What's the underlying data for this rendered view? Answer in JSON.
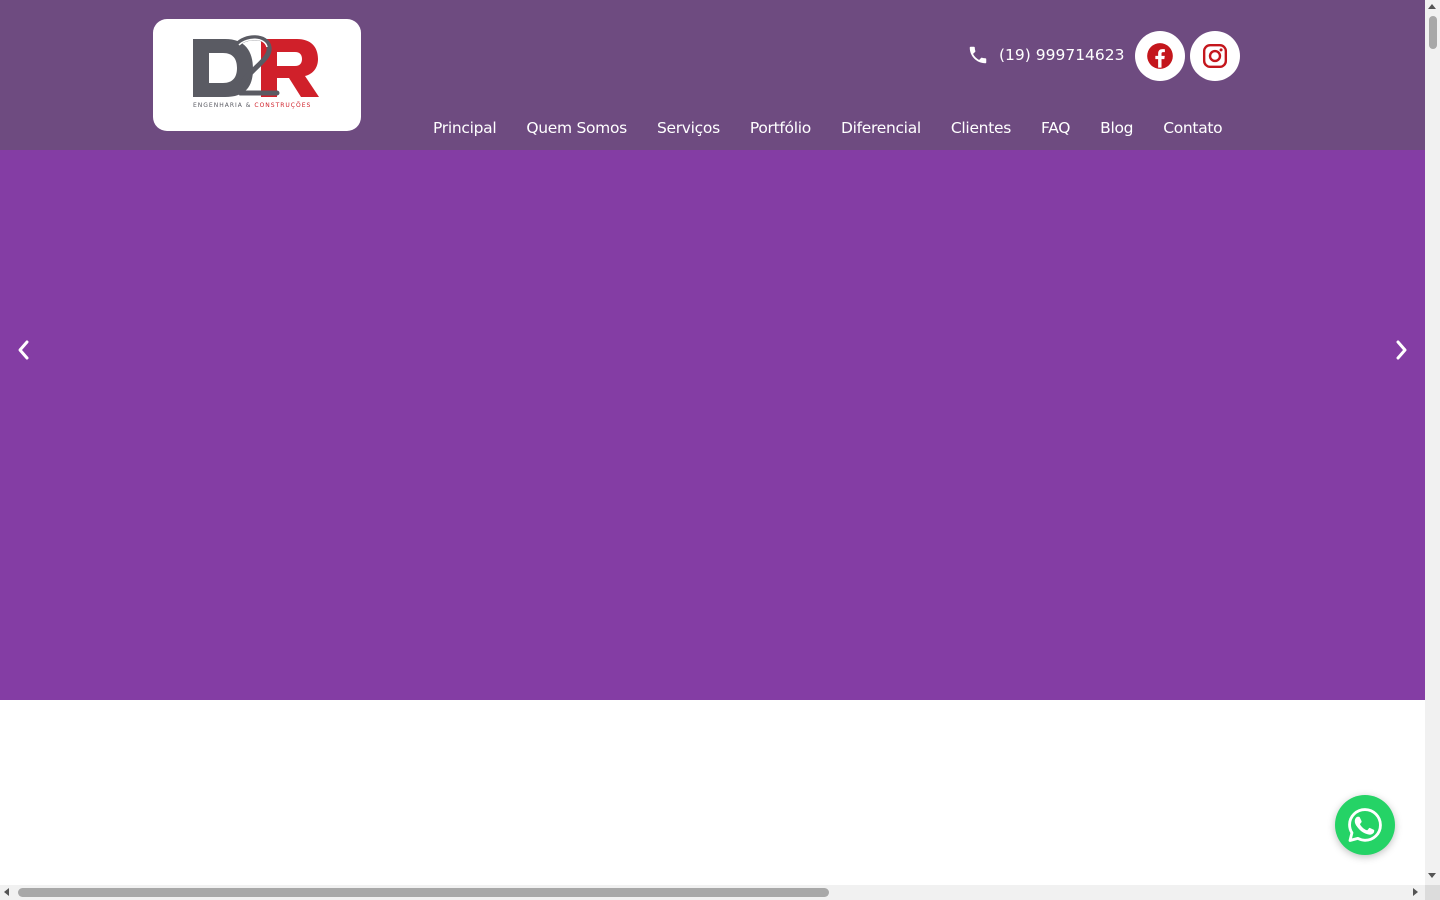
{
  "header": {
    "logo": {
      "mark": "D2R",
      "subtitle_left": "ENGENHARIA & ",
      "subtitle_right": "CONSTRUÇÕES",
      "colors": {
        "gray": "#5a5b63",
        "red": "#d0202a"
      }
    },
    "phone": {
      "icon": "phone-icon",
      "number": "(19) 999714623"
    },
    "social": [
      {
        "icon": "facebook-icon",
        "color": "#c4161c"
      },
      {
        "icon": "instagram-icon",
        "color": "#c4161c"
      }
    ],
    "nav": [
      {
        "label": "Principal"
      },
      {
        "label": "Quem Somos"
      },
      {
        "label": "Serviços"
      },
      {
        "label": "Portfólio"
      },
      {
        "label": "Diferencial"
      },
      {
        "label": "Clientes"
      },
      {
        "label": "FAQ"
      },
      {
        "label": "Blog"
      },
      {
        "label": "Contato"
      }
    ],
    "background": "#6e4b80"
  },
  "hero": {
    "background": "#843da4",
    "prev_icon": "chevron-left-icon",
    "next_icon": "chevron-right-icon"
  },
  "whatsapp": {
    "icon": "whatsapp-icon",
    "color": "#25d366"
  }
}
